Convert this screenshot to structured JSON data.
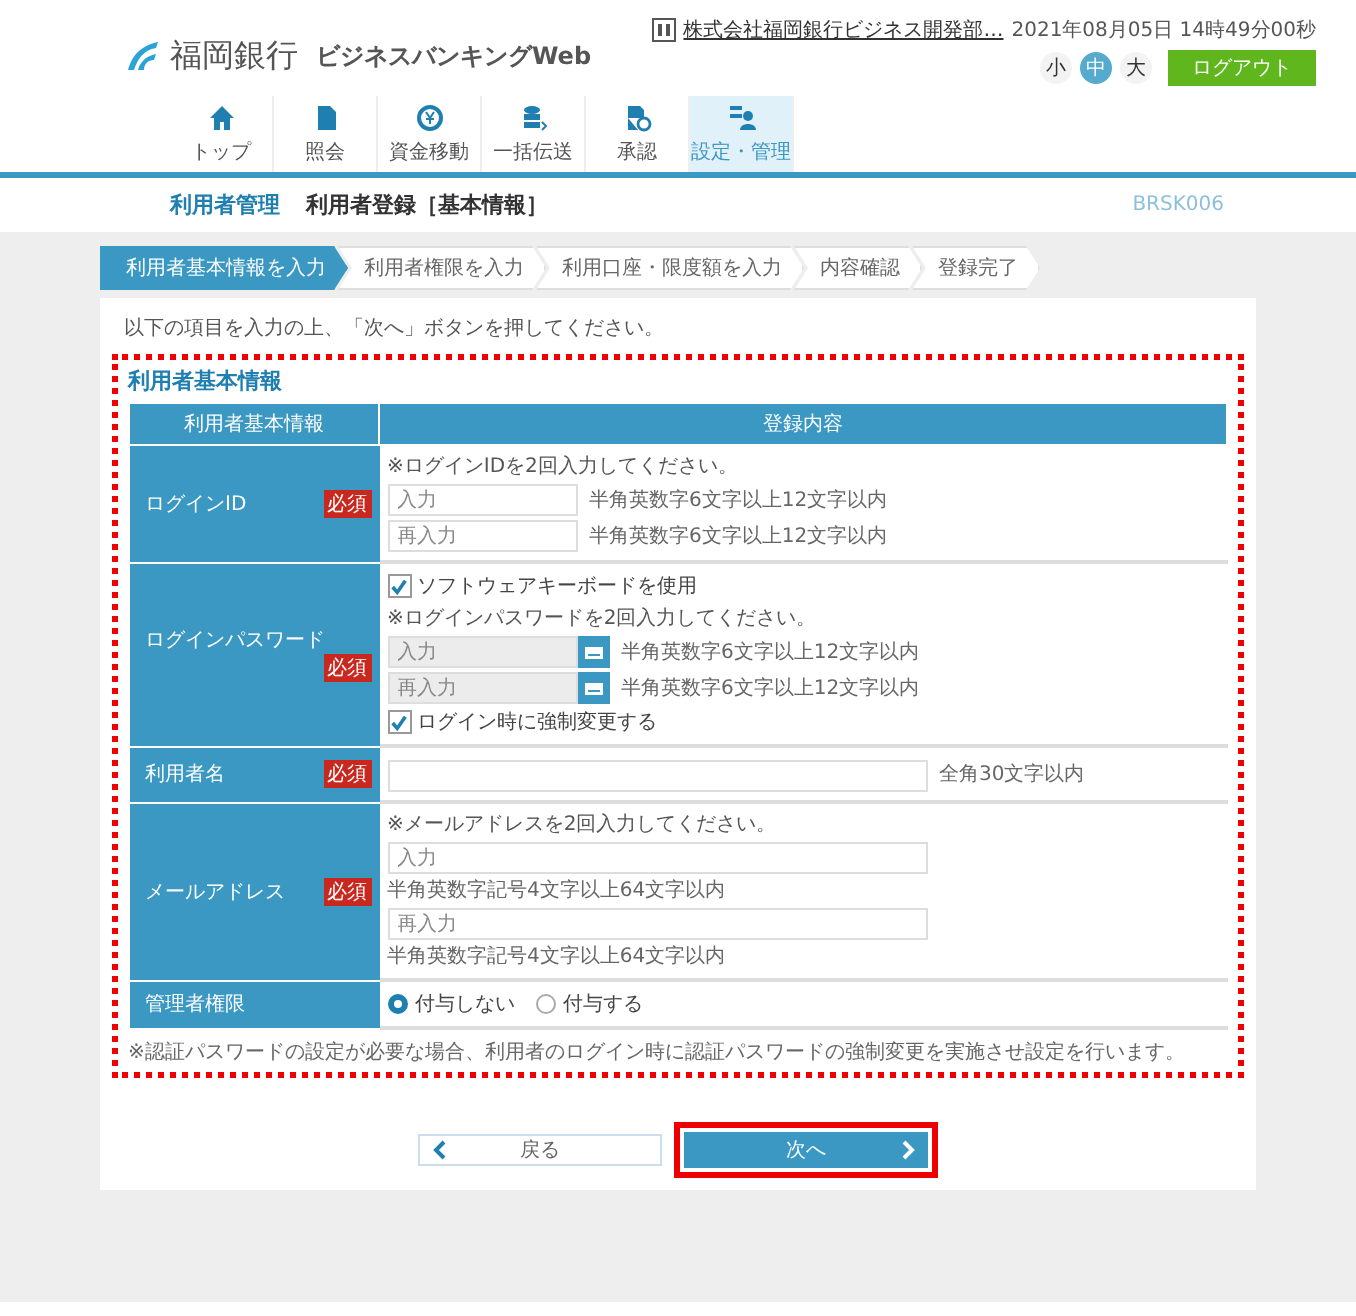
{
  "header": {
    "bank_name": "福岡銀行",
    "service_name": "ビジネスバンキングWeb",
    "company": "株式会社福岡銀行ビジネス開発部…",
    "datetime": "2021年08月05日 14時49分00秒",
    "logout": "ログアウト",
    "font_sizes": [
      {
        "label": "小",
        "selected": false
      },
      {
        "label": "中",
        "selected": true
      },
      {
        "label": "大",
        "selected": false
      }
    ]
  },
  "nav": [
    {
      "label": "トップ",
      "kind": "home",
      "selected": false
    },
    {
      "label": "照会",
      "kind": "document",
      "selected": false
    },
    {
      "label": "資金移動",
      "kind": "yen",
      "selected": false
    },
    {
      "label": "一括伝送",
      "kind": "database",
      "selected": false
    },
    {
      "label": "承認",
      "kind": "approve",
      "selected": false
    },
    {
      "label": "設定・管理",
      "kind": "users",
      "selected": true
    }
  ],
  "breadcrumb": {
    "section": "利用者管理",
    "page": "利用者登録［基本情報］",
    "screen_id": "BRSK006"
  },
  "steps": [
    {
      "label": "利用者基本情報を入力",
      "selected": true
    },
    {
      "label": "利用者権限を入力",
      "selected": false
    },
    {
      "label": "利用口座・限度額を入力",
      "selected": false
    },
    {
      "label": "内容確認",
      "selected": false
    },
    {
      "label": "登録完了",
      "selected": false
    }
  ],
  "instruction": "以下の項目を入力の上、「次へ」ボタンを押してください。",
  "form": {
    "title": "利用者基本情報",
    "highlighted": true,
    "columns": [
      "利用者基本情報",
      "登録内容"
    ],
    "rows": [
      {
        "label": "ログインID",
        "required": "必須",
        "items": [
          {
            "kind": "note",
            "text": "※ログインIDを2回入力してください。"
          },
          {
            "kind": "short_input",
            "placeholder": "入力",
            "hint": "半角英数字6文字以上12文字以内"
          },
          {
            "kind": "short_input",
            "placeholder": "再入力",
            "hint": "半角英数字6文字以上12文字以内"
          }
        ]
      },
      {
        "label": "ログインパスワード",
        "required": "必須",
        "items": [
          {
            "kind": "checkbox",
            "label": "ソフトウェアキーボードを使用",
            "checked": true
          },
          {
            "kind": "note",
            "text": "※ログインパスワードを2回入力してください。"
          },
          {
            "kind": "keyboard_input",
            "placeholder": "入力",
            "hint": "半角英数字6文字以上12文字以内"
          },
          {
            "kind": "keyboard_input",
            "placeholder": "再入力",
            "hint": "半角英数字6文字以上12文字以内"
          },
          {
            "kind": "checkbox",
            "label": "ログイン時に強制変更する",
            "checked": true
          }
        ]
      },
      {
        "label": "利用者名",
        "required": "必須",
        "items": [
          {
            "kind": "long_input",
            "hint": "全角30文字以内"
          }
        ]
      },
      {
        "label": "メールアドレス",
        "required": "必須",
        "items": [
          {
            "kind": "note",
            "text": "※メールアドレスを2回入力してください。"
          },
          {
            "kind": "stacked_input",
            "placeholder": "入力",
            "hint": "半角英数字記号4文字以上64文字以内"
          },
          {
            "kind": "stacked_input",
            "placeholder": "再入力",
            "hint": "半角英数字記号4文字以上64文字以内"
          }
        ]
      },
      {
        "label": "管理者権限",
        "items": [
          {
            "kind": "radios",
            "options": [
              {
                "label": "付与しない",
                "selected": true
              },
              {
                "label": "付与する",
                "selected": false
              }
            ]
          }
        ]
      }
    ],
    "footnote": "※認証パスワードの設定が必要な場合、利用者のログイン時に認証パスワードの強制変更を実施させ設定を行います。"
  },
  "buttons": {
    "back": {
      "label": "戻る"
    },
    "next": {
      "label": "次へ",
      "highlighted": true
    }
  }
}
